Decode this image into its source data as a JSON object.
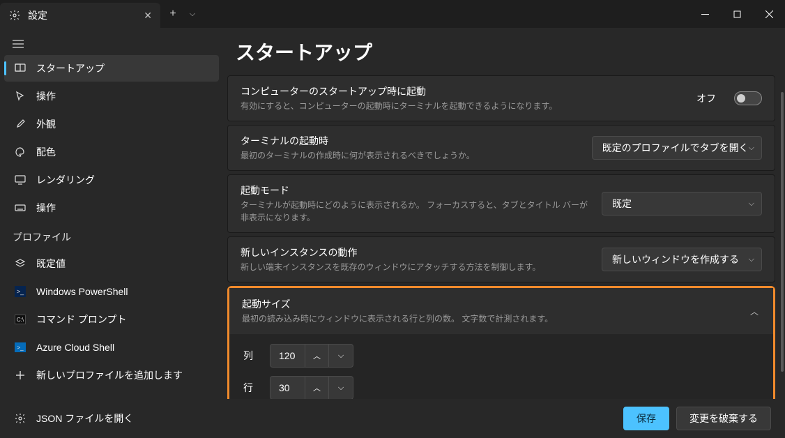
{
  "titlebar": {
    "tab_title": "設定"
  },
  "sidebar": {
    "items": [
      {
        "label": "スタートアップ"
      },
      {
        "label": "操作"
      },
      {
        "label": "外観"
      },
      {
        "label": "配色"
      },
      {
        "label": "レンダリング"
      },
      {
        "label": "操作"
      }
    ],
    "profile_header": "プロファイル",
    "profiles": [
      {
        "label": "既定値"
      },
      {
        "label": "Windows PowerShell"
      },
      {
        "label": "コマンド プロンプト"
      },
      {
        "label": "Azure Cloud Shell"
      },
      {
        "label": "新しいプロファイルを追加します"
      }
    ],
    "json_link": "JSON ファイルを開く"
  },
  "main": {
    "page_title": "スタートアップ",
    "settings": [
      {
        "title": "コンピューターのスタートアップ時に起動",
        "desc": "有効にすると、コンピューターの起動時にターミナルを起動できるようになります。",
        "toggle_state": "オフ"
      },
      {
        "title": "ターミナルの起動時",
        "desc": "最初のターミナルの作成時に何が表示されるべきでしょうか。",
        "value": "既定のプロファイルでタブを開く"
      },
      {
        "title": "起動モード",
        "desc": "ターミナルが起動時にどのように表示されるか。 フォーカスすると、タブとタイトル バーが非表示になります。",
        "value": "既定"
      },
      {
        "title": "新しいインスタンスの動作",
        "desc": "新しい端末インスタンスを既存のウィンドウにアタッチする方法を制御します。",
        "value": "新しいウィンドウを作成する"
      },
      {
        "title": "起動サイズ",
        "desc": "最初の読み込み時にウィンドウに表示される行と列の数。 文字数で計測されます。"
      }
    ],
    "launch_size": {
      "cols_label": "列",
      "cols_value": "120",
      "rows_label": "行",
      "rows_value": "30"
    }
  },
  "footer": {
    "save": "保存",
    "discard": "変更を破棄する"
  }
}
